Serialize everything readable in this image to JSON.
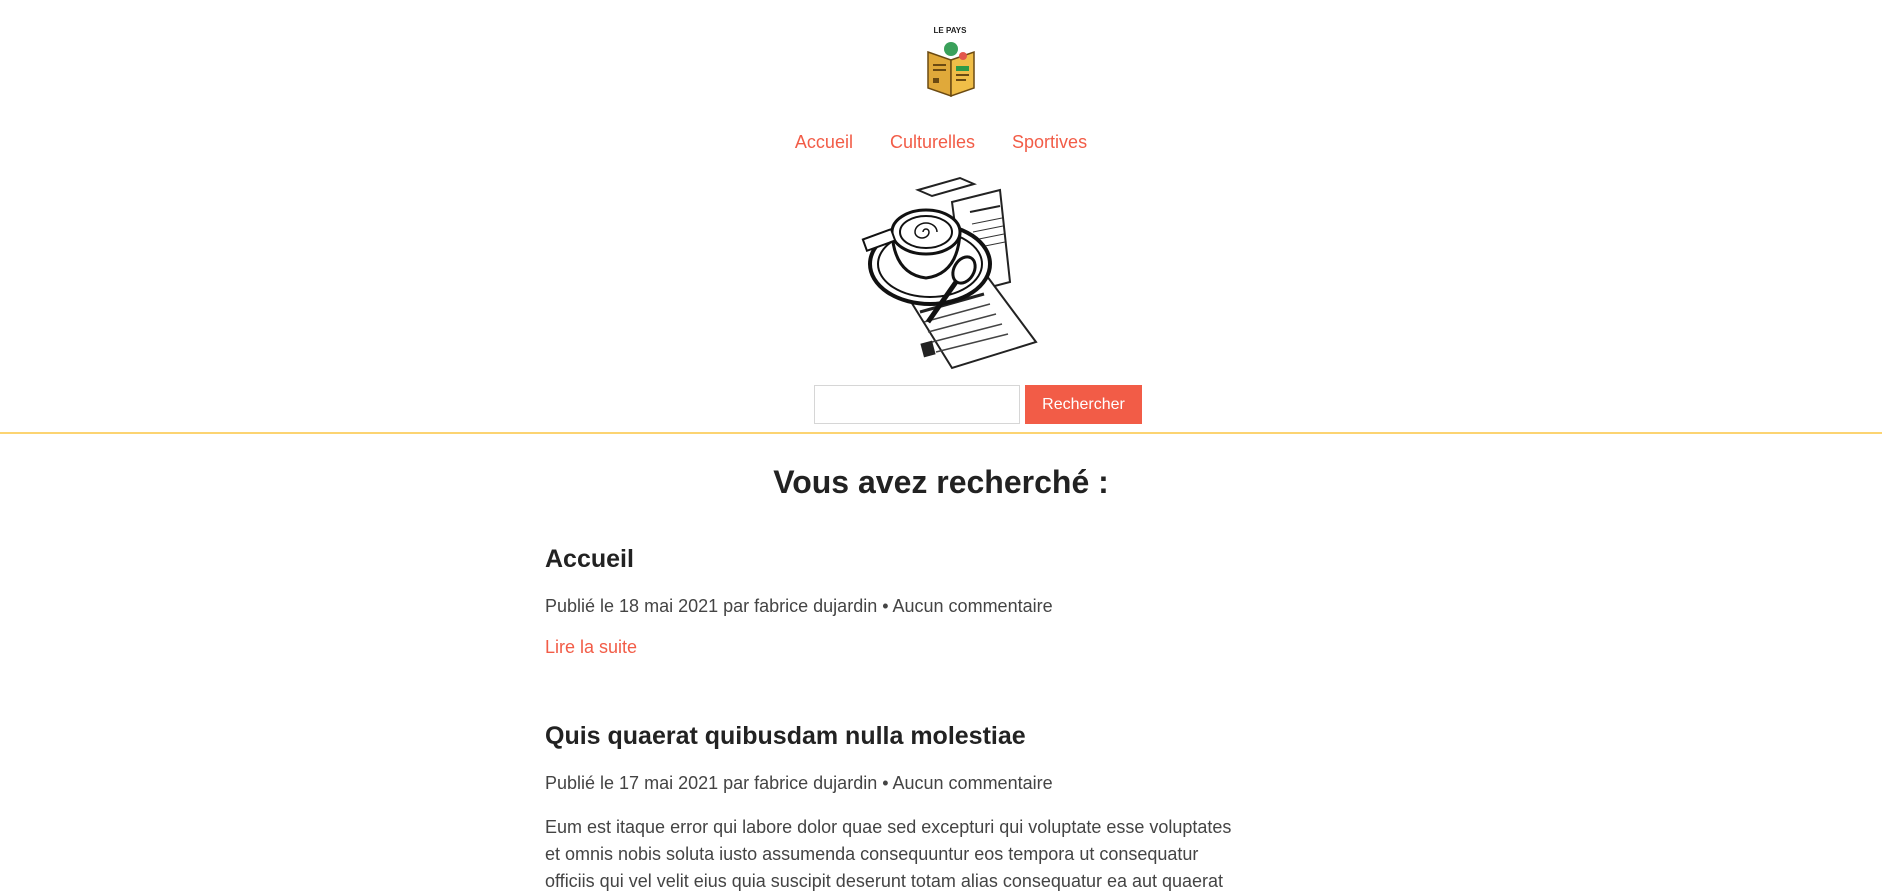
{
  "logo": {
    "text": "LE PAYS",
    "icon": "newspaper-reader-logo"
  },
  "nav": {
    "items": [
      "Accueil",
      "Culturelles",
      "Sportives"
    ]
  },
  "hero": {
    "icon": "coffee-cup-newspaper-illustration"
  },
  "search": {
    "value": "",
    "placeholder": "",
    "button_label": "Rechercher"
  },
  "page_title": "Vous avez recherché :",
  "articles": [
    {
      "title": "Accueil",
      "meta": "Publié le 18 mai 2021 par fabrice dujardin • Aucun commentaire",
      "link": "Lire la suite"
    },
    {
      "title": "Quis quaerat quibusdam nulla molestiae",
      "meta": "Publié le 17 mai 2021 par fabrice dujardin • Aucun commentaire",
      "excerpt": "Eum est itaque error qui labore dolor quae sed excepturi qui voluptate esse voluptates et omnis nobis soluta iusto assumenda consequuntur eos tempora ut consequatur officiis qui vel velit eius quia suscipit deserunt totam alias consequatur ea aut quaerat"
    }
  ],
  "colors": {
    "accent": "#f25c47",
    "divider": "#fcd472",
    "text": "#222222"
  }
}
